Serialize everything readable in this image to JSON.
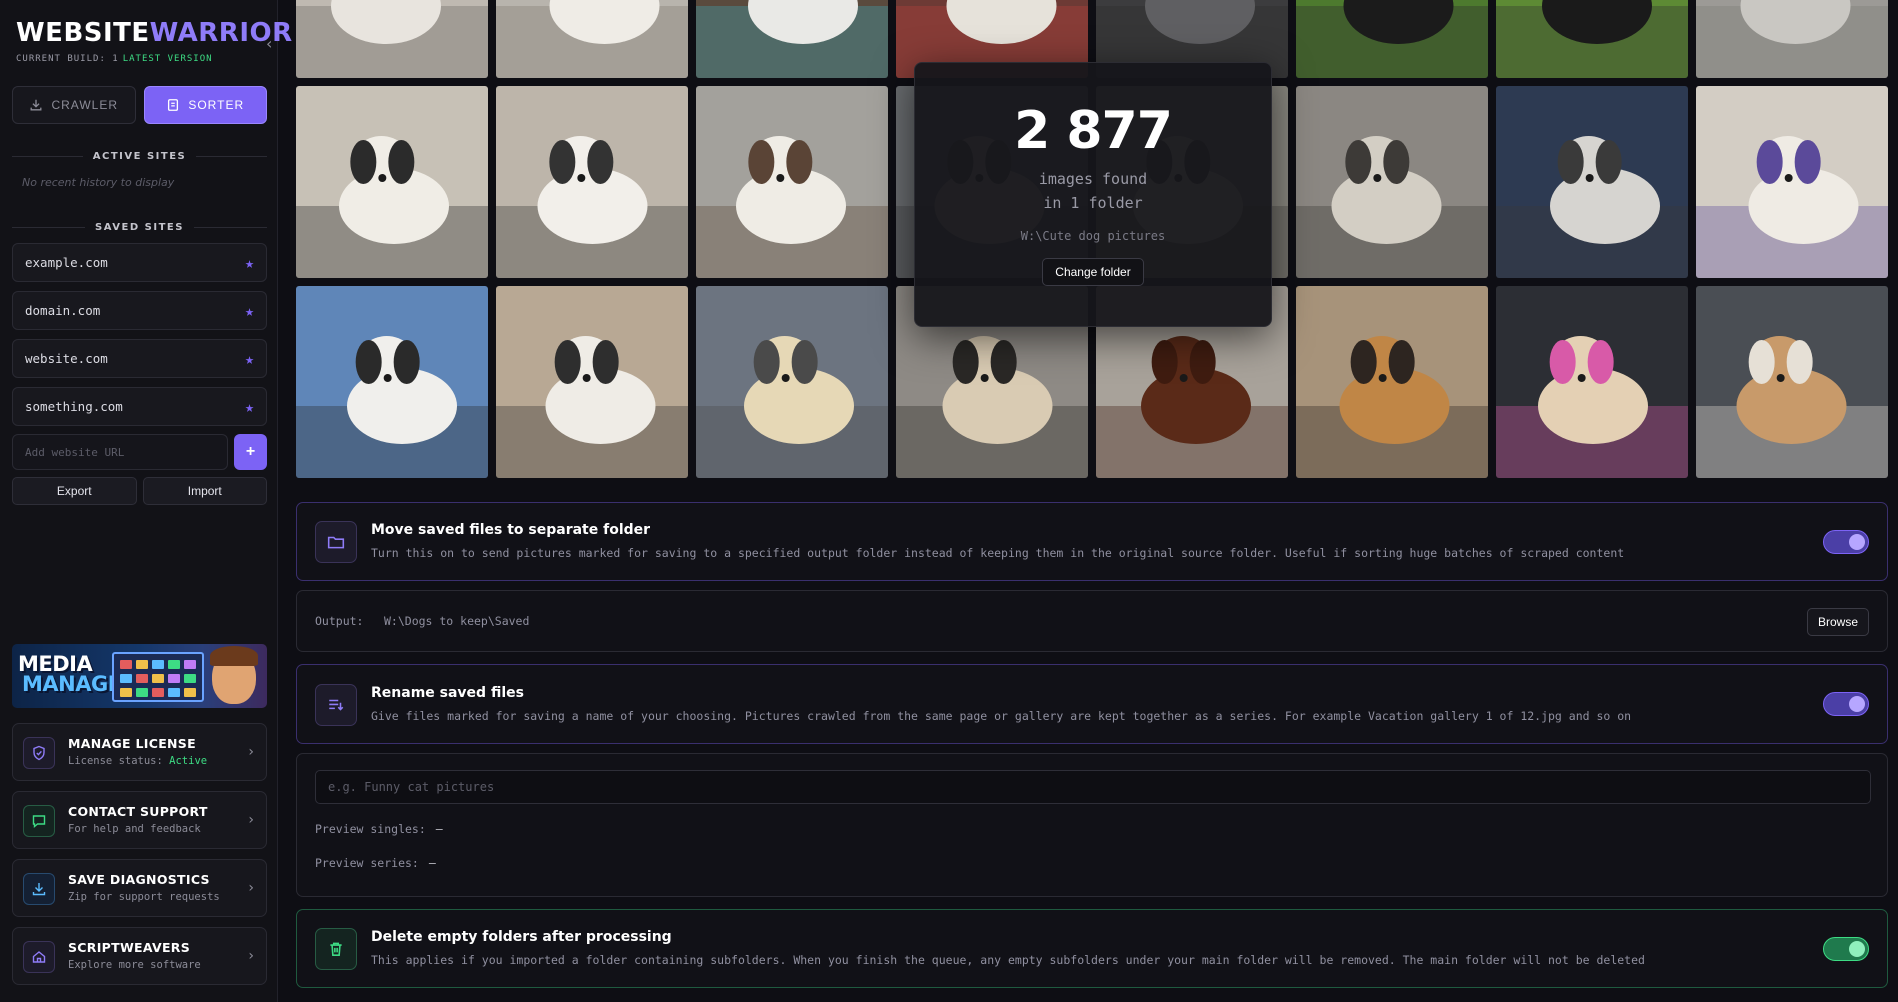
{
  "app": {
    "logo_part1": "WEBSITE",
    "logo_part2": "WARRIOR",
    "build_text": "CURRENT BUILD: 1",
    "build_status": "LATEST VERSION",
    "collapse_glyph": "‹"
  },
  "tabs": [
    {
      "label": "CRAWLER",
      "icon": "download-icon",
      "active": false
    },
    {
      "label": "SORTER",
      "icon": "sorter-icon",
      "active": true
    }
  ],
  "active_sites": {
    "heading": "ACTIVE SITES",
    "empty_text": "No recent history to display"
  },
  "saved_sites": {
    "heading": "SAVED SITES",
    "items": [
      {
        "label": "example.com"
      },
      {
        "label": "domain.com"
      },
      {
        "label": "website.com"
      },
      {
        "label": "something.com"
      }
    ],
    "star_glyph": "★"
  },
  "add_site": {
    "placeholder": "Add website URL",
    "button": "+"
  },
  "io": {
    "export_label": "Export",
    "import_label": "Import"
  },
  "banner": {
    "line1": "MEDIA",
    "line2": "MANAGER"
  },
  "cards": [
    {
      "title": "MANAGE LICENSE",
      "sub": "License status: ",
      "status": "Active",
      "icon": "shield-icon",
      "color": "#7c63f5"
    },
    {
      "title": "CONTACT SUPPORT",
      "sub": "For help and feedback",
      "icon": "chat-icon",
      "color": "#3ddc84"
    },
    {
      "title": "SAVE DIAGNOSTICS",
      "sub": "Zip for support requests",
      "icon": "download-icon",
      "color": "#5bbcff"
    },
    {
      "title": "SCRIPTWEAVERS",
      "sub": "Explore more software",
      "icon": "home-icon",
      "color": "#8f7cf8"
    }
  ],
  "card_chevron": "›",
  "summary": {
    "count": "2 877",
    "found": "images found",
    "folders": "in 1 folder",
    "path": "W:\\Cute dog pictures",
    "change_button": "Change folder"
  },
  "move_panel": {
    "title": "Move saved files to separate folder",
    "desc": "Turn this on to send pictures marked for saving to a specified output folder instead of keeping them in the original source folder. Useful if sorting huge batches of scraped content",
    "enabled": true
  },
  "output": {
    "label": "Output:",
    "path": "W:\\Dogs to keep\\Saved",
    "browse": "Browse"
  },
  "rename_panel": {
    "title": "Rename saved files",
    "desc": "Give files marked for saving a name of your choosing. Pictures crawled from the same page or gallery are kept together as a series. For example Vacation gallery 1 of 12.jpg and so on",
    "enabled": true
  },
  "rename_settings": {
    "placeholder": "e.g. Funny cat pictures",
    "preview_singles_label": "Preview singles:",
    "preview_singles_value": "—",
    "preview_series_label": "Preview series:",
    "preview_series_value": "—"
  },
  "delete_panel": {
    "title": "Delete empty folders after processing",
    "desc": "This applies if you imported a folder containing subfolders. When you finish the queue, any empty subfolders under your main folder will be removed. The main folder will not be deleted",
    "enabled": true
  },
  "thumbnails": [
    {
      "bg": "#bfb9b1",
      "fg": "#e8e4de",
      "dark": "#6b6660"
    },
    {
      "bg": "#b8b4ad",
      "fg": "#efece6",
      "dark": "#7d776f"
    },
    {
      "bg": "#5a4a3d",
      "fg": "#e9e9e6",
      "dark": "#3fa7b8"
    },
    {
      "bg": "#6d3a35",
      "fg": "#e6e2da",
      "dark": "#b6423c"
    },
    {
      "bg": "#3c3c3e",
      "fg": "#5f5f62",
      "dark": "#2a2a2c"
    },
    {
      "bg": "#4d7a2e",
      "fg": "#1b1b1b",
      "dark": "#2a2a2a"
    },
    {
      "bg": "#5d8a34",
      "fg": "#1a1a1a",
      "dark": "#303030"
    },
    {
      "bg": "#9c9a96",
      "fg": "#c9c7c2",
      "dark": "#7c7a76"
    },
    {
      "bg": "#c7c1b6",
      "fg": "#f0ede6",
      "dark": "#2b2b2b"
    },
    {
      "bg": "#bdb5aa",
      "fg": "#f2efea",
      "dark": "#333333"
    },
    {
      "bg": "#a3a19c",
      "fg": "#efece5",
      "dark": "#5a4436"
    },
    {
      "bg": "#6a6d70",
      "fg": "#b9b6b0",
      "dark": "#3a3a3c"
    },
    {
      "bg": "#8a8880",
      "fg": "#d6d2c8",
      "dark": "#454443"
    },
    {
      "bg": "#8b8782",
      "fg": "#d3cec4",
      "dark": "#3d3a37"
    },
    {
      "bg": "#2d3a52",
      "fg": "#d6d4d0",
      "dark": "#3a3a3a"
    },
    {
      "bg": "#d3cdc4",
      "fg": "#efebe4",
      "dark": "#5b4a9a"
    },
    {
      "bg": "#5f86b8",
      "fg": "#f0efec",
      "dark": "#2a2a2a"
    },
    {
      "bg": "#b8a894",
      "fg": "#efece6",
      "dark": "#2e2e2e"
    },
    {
      "bg": "#6c7480",
      "fg": "#e6d8b6",
      "dark": "#4a4a4a"
    },
    {
      "bg": "#8e8a85",
      "fg": "#d9cbb3",
      "dark": "#2a2826"
    },
    {
      "bg": "#a8a29a",
      "fg": "#5a2a18",
      "dark": "#3f1c10"
    },
    {
      "bg": "#a7937a",
      "fg": "#c08646",
      "dark": "#2d2520"
    },
    {
      "bg": "#2c2e34",
      "fg": "#e4d0b4",
      "dark": "#d85aa8"
    },
    {
      "bg": "#4a4e54",
      "fg": "#c89a6a",
      "dark": "#e6e0d6"
    }
  ]
}
